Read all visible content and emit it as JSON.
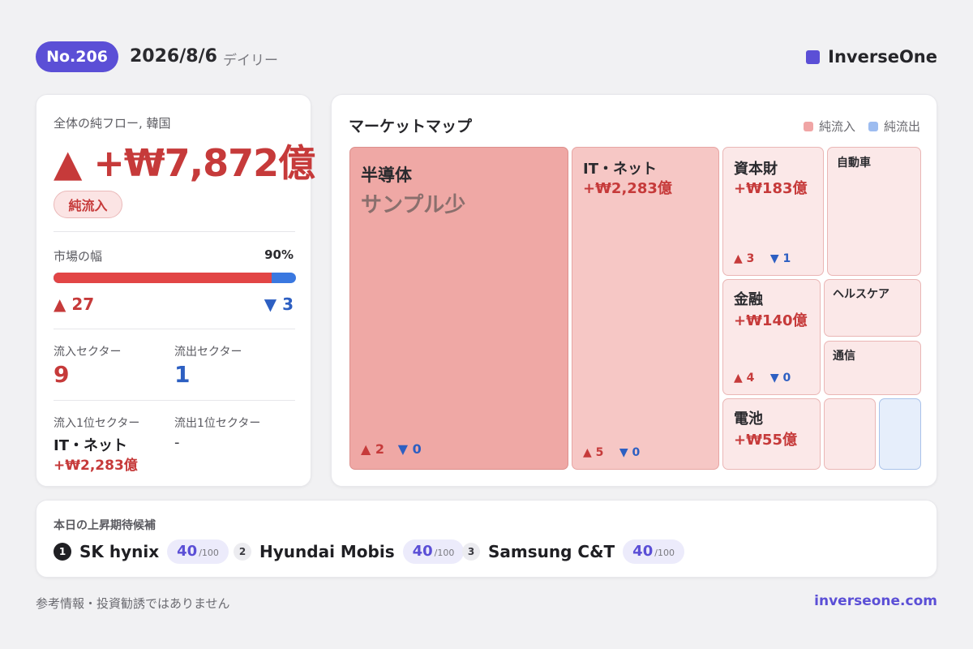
{
  "header": {
    "issue_badge": "No.206",
    "date": "2026/8/6",
    "kind": "デイリー",
    "brand": "InverseOne"
  },
  "colors": {
    "brand": "#5b4fd6",
    "inflow": "#c63a3a",
    "outflow": "#2d5fc2"
  },
  "summary": {
    "title": "全体の純フロー, 韓国",
    "total": "▲ +₩7,872億",
    "status_pill": "純流入",
    "breadth": {
      "label": "市場の幅",
      "percent_label": "90%",
      "percent_value": 90,
      "up": "▲ 27",
      "down": "▼ 3"
    },
    "inflow_sectors_label": "流入セクター",
    "inflow_sectors": "9",
    "outflow_sectors_label": "流出セクター",
    "outflow_sectors": "1",
    "top_inflow_label": "流入1位セクター",
    "top_inflow_name": "IT・ネット",
    "top_inflow_value": "+₩2,283億",
    "top_outflow_label": "流出1位セクター",
    "top_outflow_name": "-"
  },
  "market_map": {
    "title": "マーケットマップ",
    "legend_inflow": "純流入",
    "legend_outflow": "純流出",
    "tiles": {
      "semis": {
        "name": "半導体",
        "note": "サンプル少",
        "up": "▲ 2",
        "down": "▼ 0"
      },
      "it": {
        "name": "IT・ネット",
        "value": "+₩2,283億",
        "up": "▲ 5",
        "down": "▼ 0"
      },
      "capital": {
        "name": "資本財",
        "value": "+₩183億",
        "up": "▲ 3",
        "down": "▼ 1"
      },
      "auto": {
        "name": "自動車"
      },
      "finance": {
        "name": "金融",
        "value": "+₩140億",
        "up": "▲ 4",
        "down": "▼ 0"
      },
      "health": {
        "name": "ヘルスケア"
      },
      "telecom": {
        "name": "通信"
      },
      "battery": {
        "name": "電池",
        "value": "+₩55億"
      }
    }
  },
  "candidates": {
    "title": "本日の上昇期待候補",
    "items": [
      {
        "rank": "1",
        "name": "SK hynix",
        "score": "40",
        "max": "/100"
      },
      {
        "rank": "2",
        "name": "Hyundai Mobis",
        "score": "40",
        "max": "/100"
      },
      {
        "rank": "3",
        "name": "Samsung C&T",
        "score": "40",
        "max": "/100"
      }
    ]
  },
  "footer": {
    "disclaimer": "参考情報・投資勧誘ではありません",
    "url": "inverseone.com"
  }
}
